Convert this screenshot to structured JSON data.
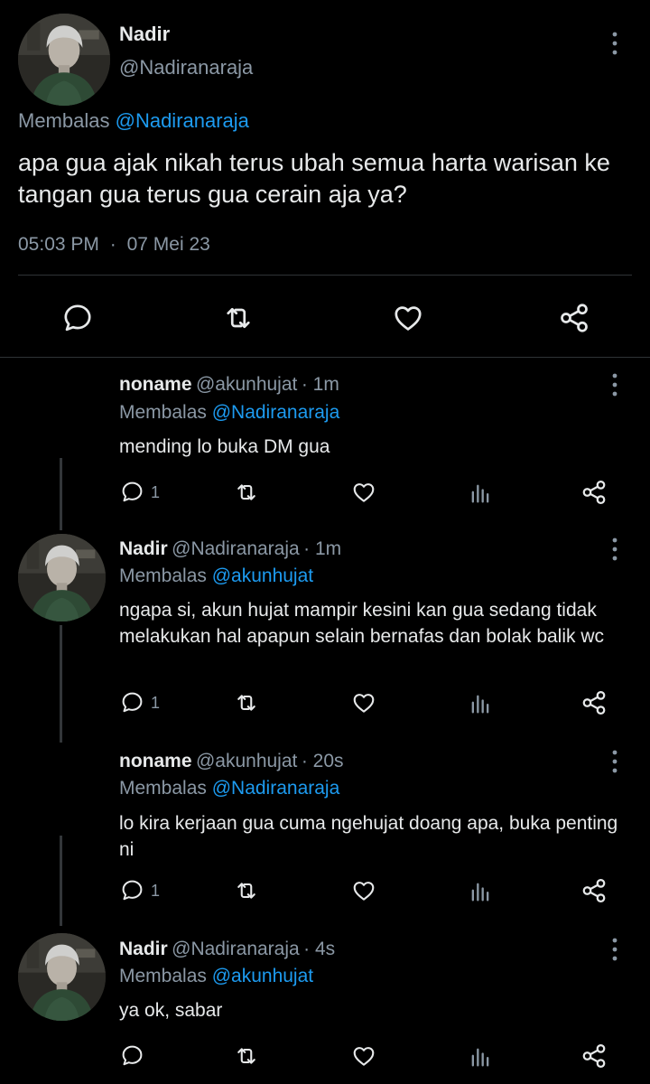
{
  "main_tweet": {
    "name": "Nadir",
    "handle": "@Nadiranaraja",
    "reply_prefix": "Membalas",
    "reply_to": "@Nadiranaraja",
    "text": "apa gua ajak nikah terus ubah semua harta warisan ke tangan gua terus gua cerain aja ya?",
    "time": "05:03 PM",
    "separator": "·",
    "date": "07 Mei 23"
  },
  "replies": [
    {
      "name": "noname",
      "handle": "@akunhujat",
      "time": "· 1m",
      "reply_prefix": "Membalas",
      "reply_to": "@Nadiranaraja",
      "text": "mending lo buka DM gua",
      "reply_count": "1"
    },
    {
      "name": "Nadir",
      "handle": "@Nadiranaraja",
      "time": "· 1m",
      "reply_prefix": "Membalas",
      "reply_to": "@akunhujat",
      "text": "ngapa si, akun hujat mampir kesini kan gua sedang tidak melakukan hal apapun selain bernafas dan bolak balik wc",
      "reply_count": "1"
    },
    {
      "name": "noname",
      "handle": "@akunhujat",
      "time": "· 20s",
      "reply_prefix": "Membalas",
      "reply_to": "@Nadiranaraja",
      "text": "lo kira kerjaan gua cuma ngehujat doang apa, buka penting ni",
      "reply_count": "1"
    },
    {
      "name": "Nadir",
      "handle": "@Nadiranaraja",
      "time": "· 4s",
      "reply_prefix": "Membalas",
      "reply_to": "@akunhujat",
      "text": "ya ok, sabar",
      "reply_count": ""
    }
  ],
  "icons": {
    "reply": "comment-icon",
    "retweet": "retweet-icon",
    "like": "heart-icon",
    "views": "analytics-icon",
    "share": "share-icon",
    "more": "more-vertical-icon"
  },
  "colors": {
    "background": "#000000",
    "text": "#e7e9ea",
    "muted": "#8b98a5",
    "link": "#1d9bf0"
  }
}
